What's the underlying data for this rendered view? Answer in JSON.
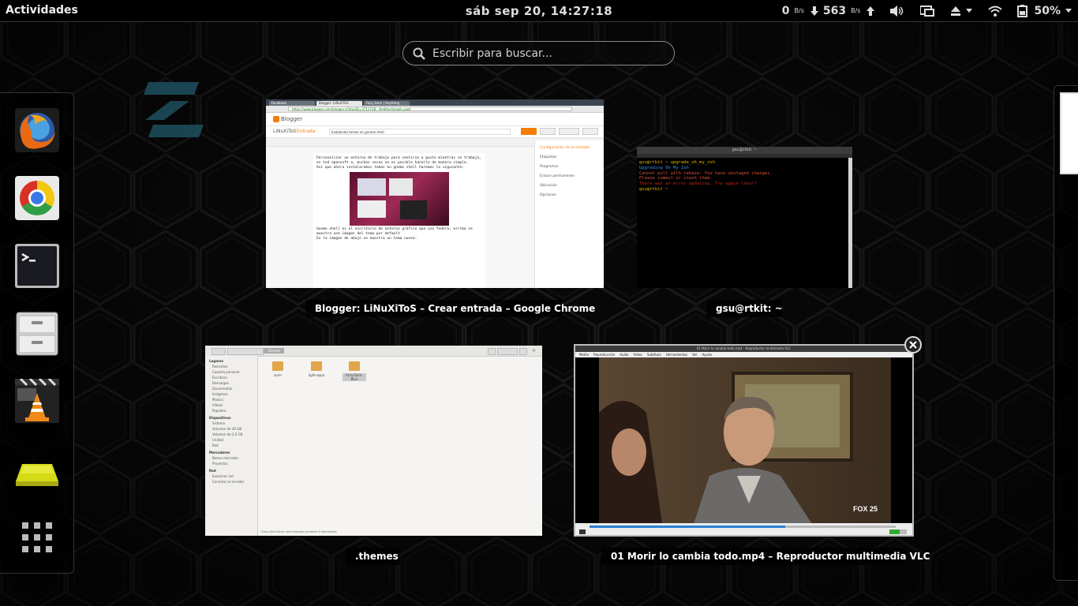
{
  "top_panel": {
    "activities": "Actividades",
    "clock": "sáb sep 20, 14:27:18",
    "net_down": "0",
    "net_down_unit": "B/s",
    "net_up": "563",
    "net_up_unit": "B/s",
    "battery": "50%"
  },
  "search": {
    "placeholder": "Escribir para buscar..."
  },
  "dash": {
    "items": [
      {
        "name": "Firefox",
        "icon": "firefox-icon"
      },
      {
        "name": "Google Chrome",
        "icon": "chrome-icon"
      },
      {
        "name": "Terminal",
        "icon": "terminal-icon"
      },
      {
        "name": "Archivos",
        "icon": "file-cabinet-icon"
      },
      {
        "name": "VLC",
        "icon": "vlc-icon"
      },
      {
        "name": "Unidad",
        "icon": "drive-icon"
      },
      {
        "name": "Mostrar aplicaciones",
        "icon": "app-grid-icon"
      }
    ]
  },
  "windows": {
    "chrome": {
      "caption": "Blogger: LiNuXiToS – Crear entrada – Google Chrome",
      "tabs": [
        "Facebook",
        "Blogger: LiNuXiToS",
        "Fairy Dark | Anything"
      ],
      "url": "https://www.blogger.com/blogger.g?blogID=3711728…#editor/target=post",
      "blog_name": "LiNuXiToS",
      "section": "· Entrada",
      "post_title": "Instalando temas en gnome shell",
      "editor_lines": [
        "Personalizar un entorno de trabajo para sentirse a gusto mientras se trabaja,",
        "es tod opensoft a, muchas veces no es posible hacerlo de manera simple.",
        "Así que ahora instalaremos temas en gnome shell haremos lo siguiente:",
        "Gnome shell es el escritorio de entorno gráfico que usa fedora, arriba se",
        "muestra una imagen del tema por default",
        "En la imagen de abajo se muestra un tema nuevo:"
      ],
      "side_items": [
        "Configuración de la entrada",
        "Etiquetas",
        "Programar",
        "Enlace permanente",
        "Ubicación",
        "Opciones"
      ]
    },
    "terminal": {
      "caption": "gsu@rtkit: ~",
      "title": "gsu@rtkit: ~",
      "lines": [
        {
          "text": "gsu@rtkit  ~ upgrade_oh_my_zsh",
          "color": "#e6b800"
        },
        {
          "text": "Upgrading Oh My Zsh",
          "color": "#3b8eea"
        },
        {
          "text": "Cannot pull with rebase: You have unstaged changes.",
          "color": "#e0503a"
        },
        {
          "text": "Please commit or stash them.",
          "color": "#e0503a"
        },
        {
          "text": "There was an error updating. Try again later?",
          "color": "#c02a1a"
        },
        {
          "text": "gsu@rtkit  ~",
          "color": "#e6b800"
        }
      ]
    },
    "files": {
      "caption": ".themes",
      "path_button": ".themes",
      "sidebar": [
        {
          "heading": "Lugares",
          "items": [
            "Recientes",
            "Carpeta personal",
            "Escritorio",
            "Descargas",
            "Documentos",
            "Imágenes",
            "Música",
            "Vídeos",
            "Papelera"
          ]
        },
        {
          "heading": "Dispositivos",
          "items": [
            "Sistema",
            "Volumen de 40 GB",
            "Volumen de 2,0 GB",
            "Unidad",
            "Red"
          ]
        },
        {
          "heading": "Marcadores",
          "items": [
            "Nuevo marcador",
            "Proyectos"
          ]
        },
        {
          "heading": "Red",
          "items": [
            "Examinar red",
            "Conectar al servidor"
          ]
        }
      ],
      "folders": [
        "zorin",
        "light-aqua",
        "Fairy-Dark-Blue"
      ],
      "status": "«Fairy-Dark-Blue» seleccionado (contiene 5 elementos)"
    },
    "vlc": {
      "caption": "01 Morir lo cambia todo.mp4 – Reproductor multimedia VLC",
      "title": "01 Morir lo cambia todo.mp4 - Reproductor multimedia VLC",
      "menu": [
        "Medio",
        "Reproducción",
        "Audio",
        "Vídeo",
        "Subtítulo",
        "Herramientas",
        "Ver",
        "Ayuda"
      ],
      "watermark": "FOX 25",
      "progress": 0.64
    }
  },
  "colors": {
    "accent": "#2aa3c7",
    "panel": "#000000"
  }
}
